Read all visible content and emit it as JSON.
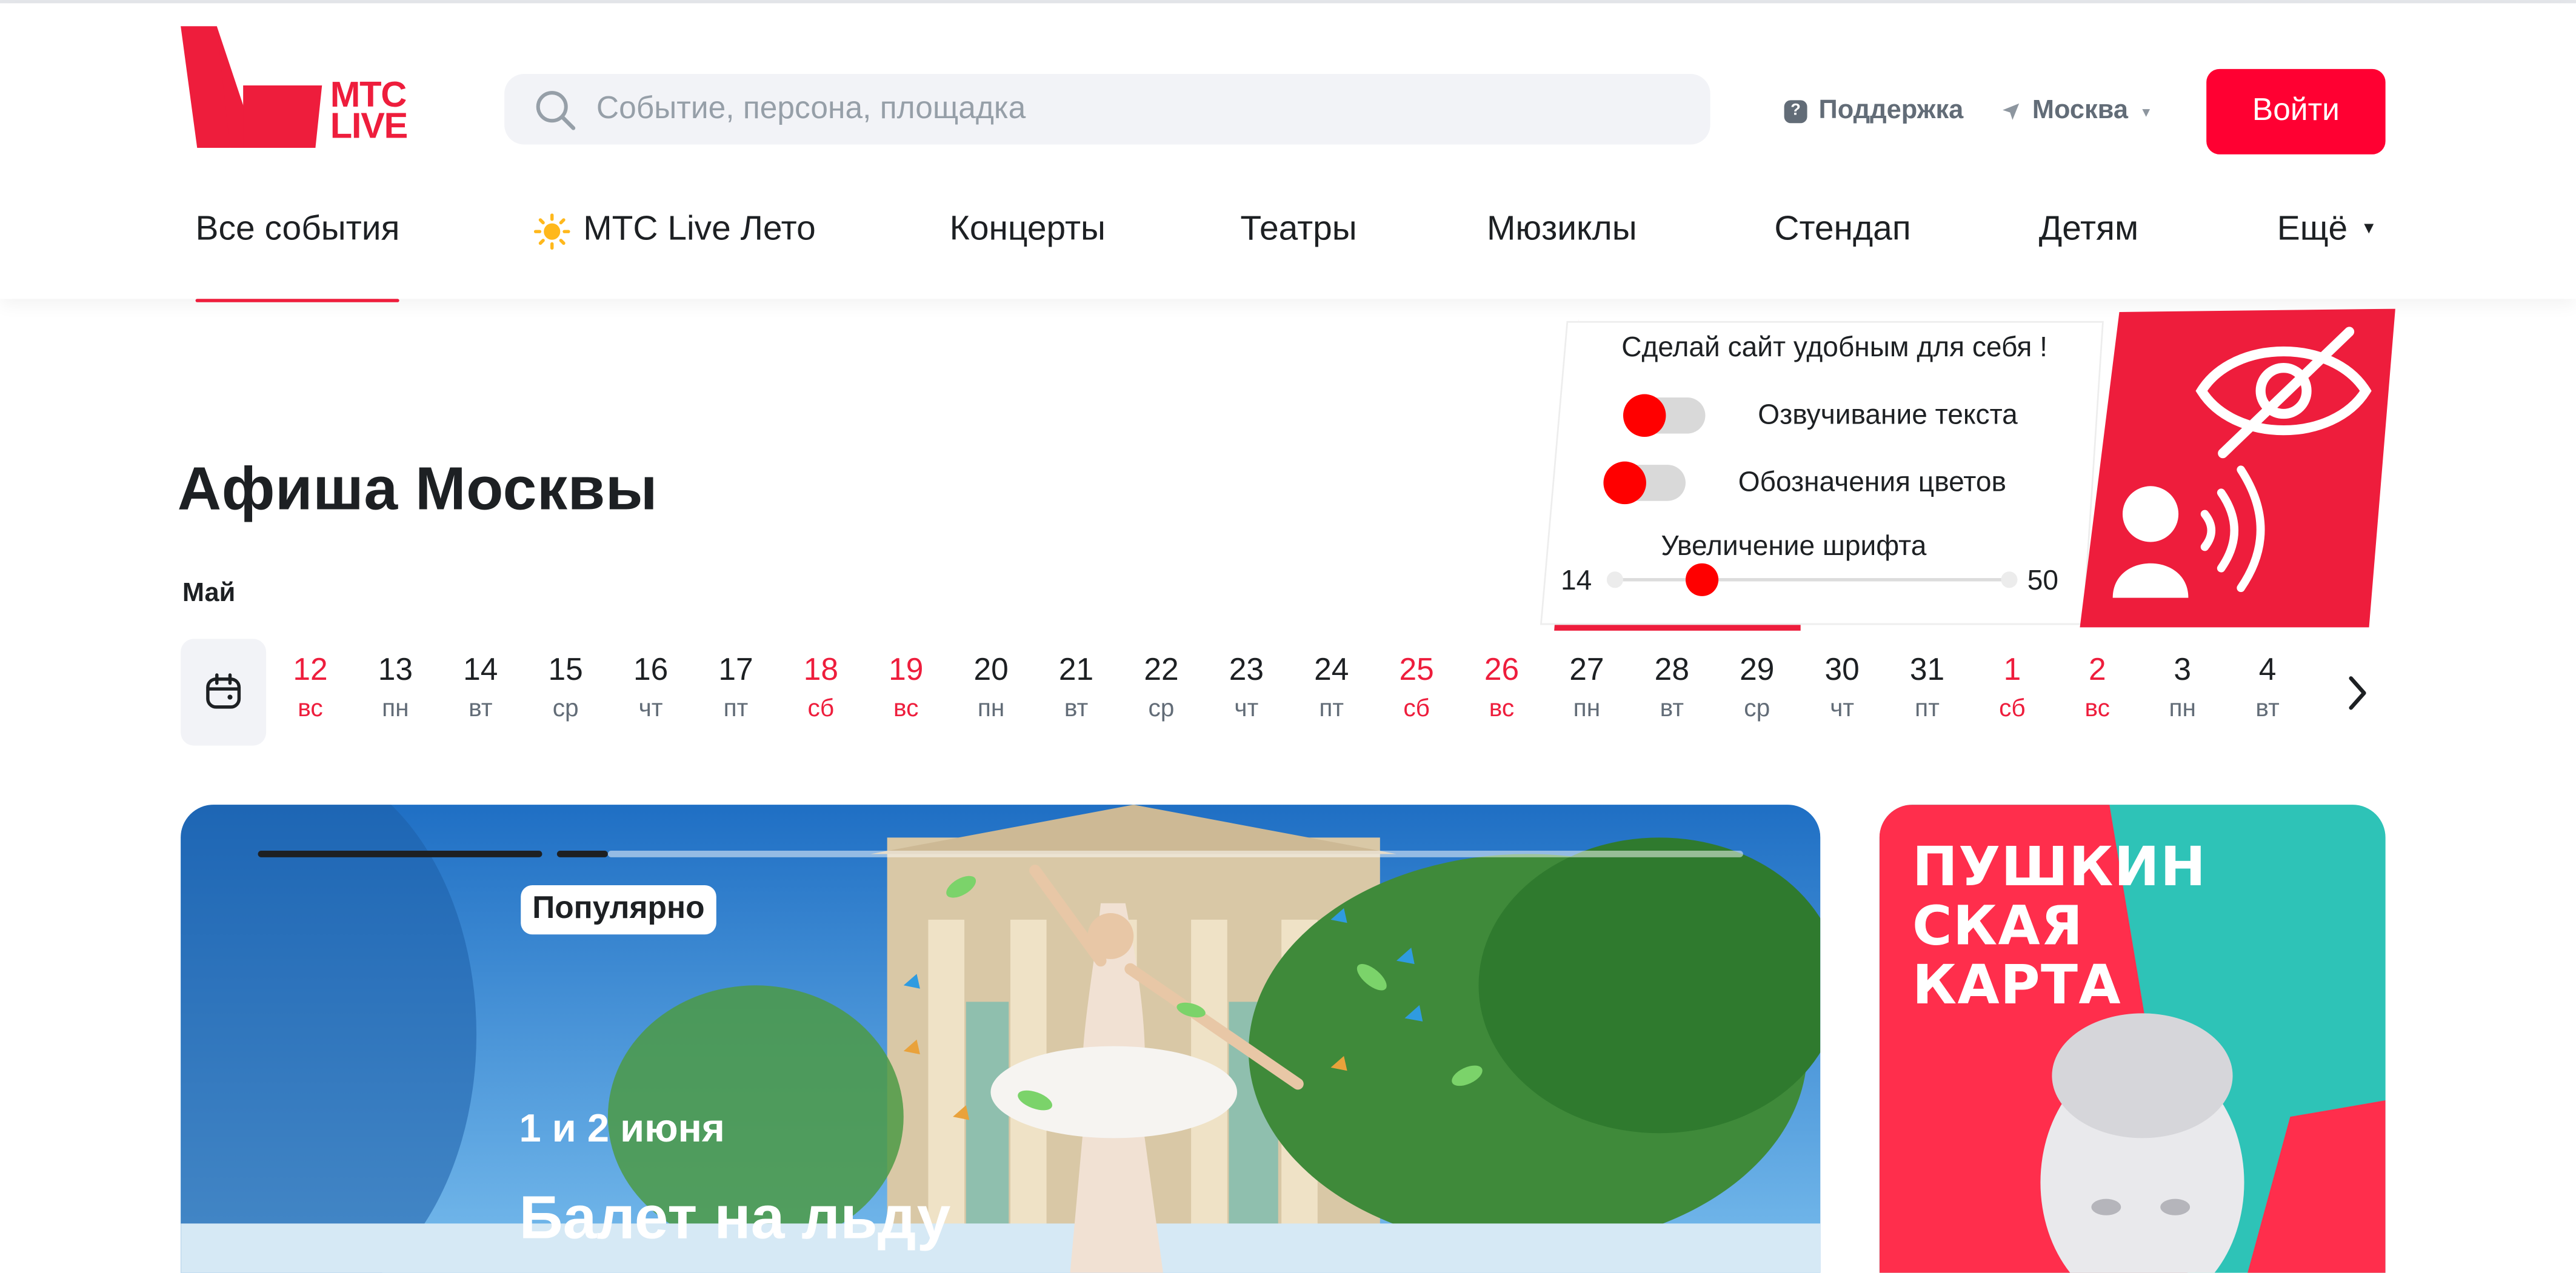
{
  "brand": {
    "logo_text_line1": "МТС",
    "logo_text_line2": "LIVE",
    "accent_color": "#ee1d3c",
    "button_color": "#ff0032"
  },
  "search": {
    "placeholder": "Событие, персона, площадка",
    "icon": "search-icon"
  },
  "header_links": {
    "support": "Поддержка",
    "city": "Москва",
    "login": "Войти"
  },
  "nav": {
    "items": [
      {
        "label": "Все события",
        "active": true
      },
      {
        "label": "МТС Live Лето",
        "icon": "sun-icon"
      },
      {
        "label": "Концерты"
      },
      {
        "label": "Театры"
      },
      {
        "label": "Мюзиклы"
      },
      {
        "label": "Стендап"
      },
      {
        "label": "Детям"
      },
      {
        "label": "Ещё",
        "icon": "caret-down-icon"
      }
    ]
  },
  "page": {
    "title": "Афиша Москвы",
    "month": "Май"
  },
  "calendar": {
    "days": [
      {
        "num": "12",
        "wd": "вс",
        "weekend": true
      },
      {
        "num": "13",
        "wd": "пн"
      },
      {
        "num": "14",
        "wd": "вт"
      },
      {
        "num": "15",
        "wd": "ср"
      },
      {
        "num": "16",
        "wd": "чт"
      },
      {
        "num": "17",
        "wd": "пт"
      },
      {
        "num": "18",
        "wd": "сб",
        "weekend": true
      },
      {
        "num": "19",
        "wd": "вс",
        "weekend": true
      },
      {
        "num": "20",
        "wd": "пн"
      },
      {
        "num": "21",
        "wd": "вт"
      },
      {
        "num": "22",
        "wd": "ср"
      },
      {
        "num": "23",
        "wd": "чт"
      },
      {
        "num": "24",
        "wd": "пт"
      },
      {
        "num": "25",
        "wd": "сб",
        "weekend": true
      },
      {
        "num": "26",
        "wd": "вс",
        "weekend": true
      },
      {
        "num": "27",
        "wd": "пн"
      },
      {
        "num": "28",
        "wd": "вт"
      },
      {
        "num": "29",
        "wd": "ср"
      },
      {
        "num": "30",
        "wd": "чт"
      },
      {
        "num": "31",
        "wd": "пт"
      },
      {
        "num": "1",
        "wd": "сб",
        "weekend": true
      },
      {
        "num": "2",
        "wd": "вс",
        "weekend": true
      },
      {
        "num": "3",
        "wd": "пн"
      },
      {
        "num": "4",
        "wd": "вт"
      }
    ]
  },
  "banner": {
    "badge": "Популярно",
    "date": "1 и 2 июня",
    "title": "Балет на льду",
    "colors": {
      "sky": "#3b8fd8",
      "foliage": "#3f8a3a"
    }
  },
  "promo": {
    "line1": "ПУШКИН",
    "line2": "СКАЯ",
    "line3": "КАРТА",
    "colors": {
      "teal": "#2ec3b7",
      "red": "#ff2e4c"
    }
  },
  "accessibility": {
    "heading": "Сделай сайт удобным для себя !",
    "toggle_speech": "Озвучивание текста",
    "toggle_colors": "Обозначения цветов",
    "font_label": "Увеличение шрифта",
    "font_min": "14",
    "font_max": "50",
    "font_value": 22,
    "speech_on": false,
    "colors_on": false
  }
}
